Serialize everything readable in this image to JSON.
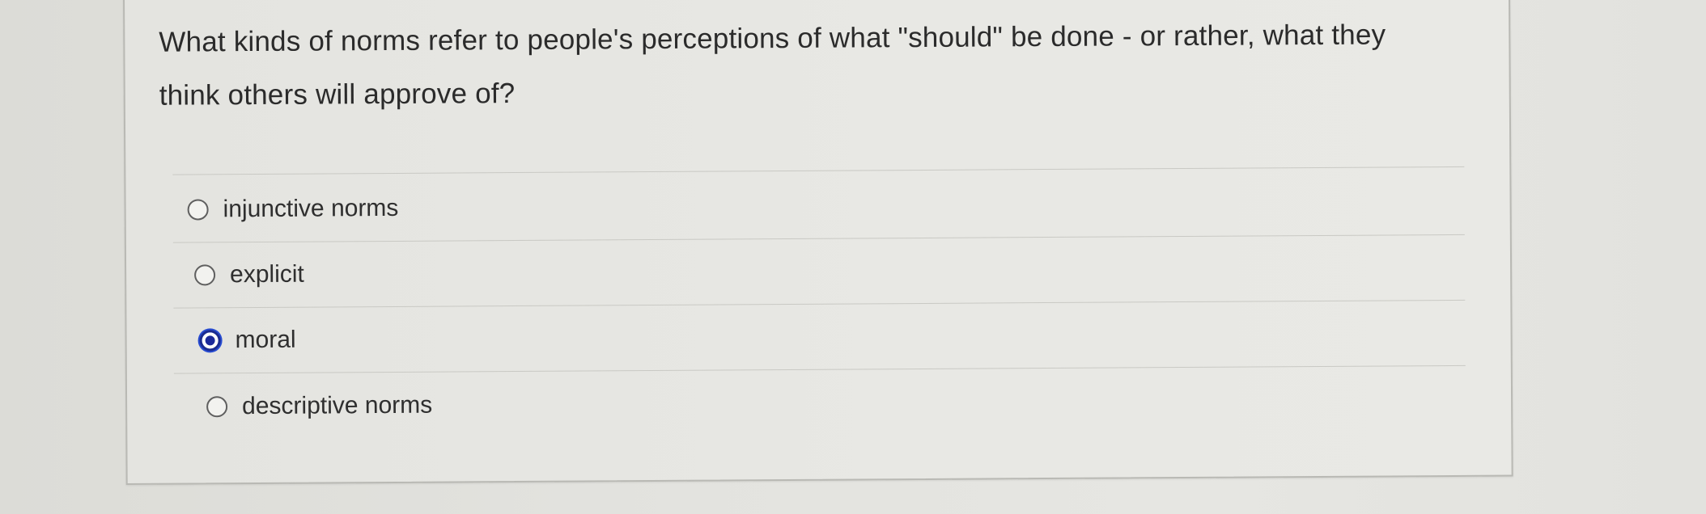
{
  "question": {
    "text": "What kinds of norms refer to people's perceptions of what \"should\" be done - or rather, what they think others will approve of?"
  },
  "options": [
    {
      "label": "injunctive norms",
      "selected": false
    },
    {
      "label": "explicit",
      "selected": false
    },
    {
      "label": "moral",
      "selected": true
    },
    {
      "label": "descriptive norms",
      "selected": false
    }
  ],
  "colors": {
    "selected_radio": "#1c2a9a",
    "page_background": "#e3e3df"
  }
}
